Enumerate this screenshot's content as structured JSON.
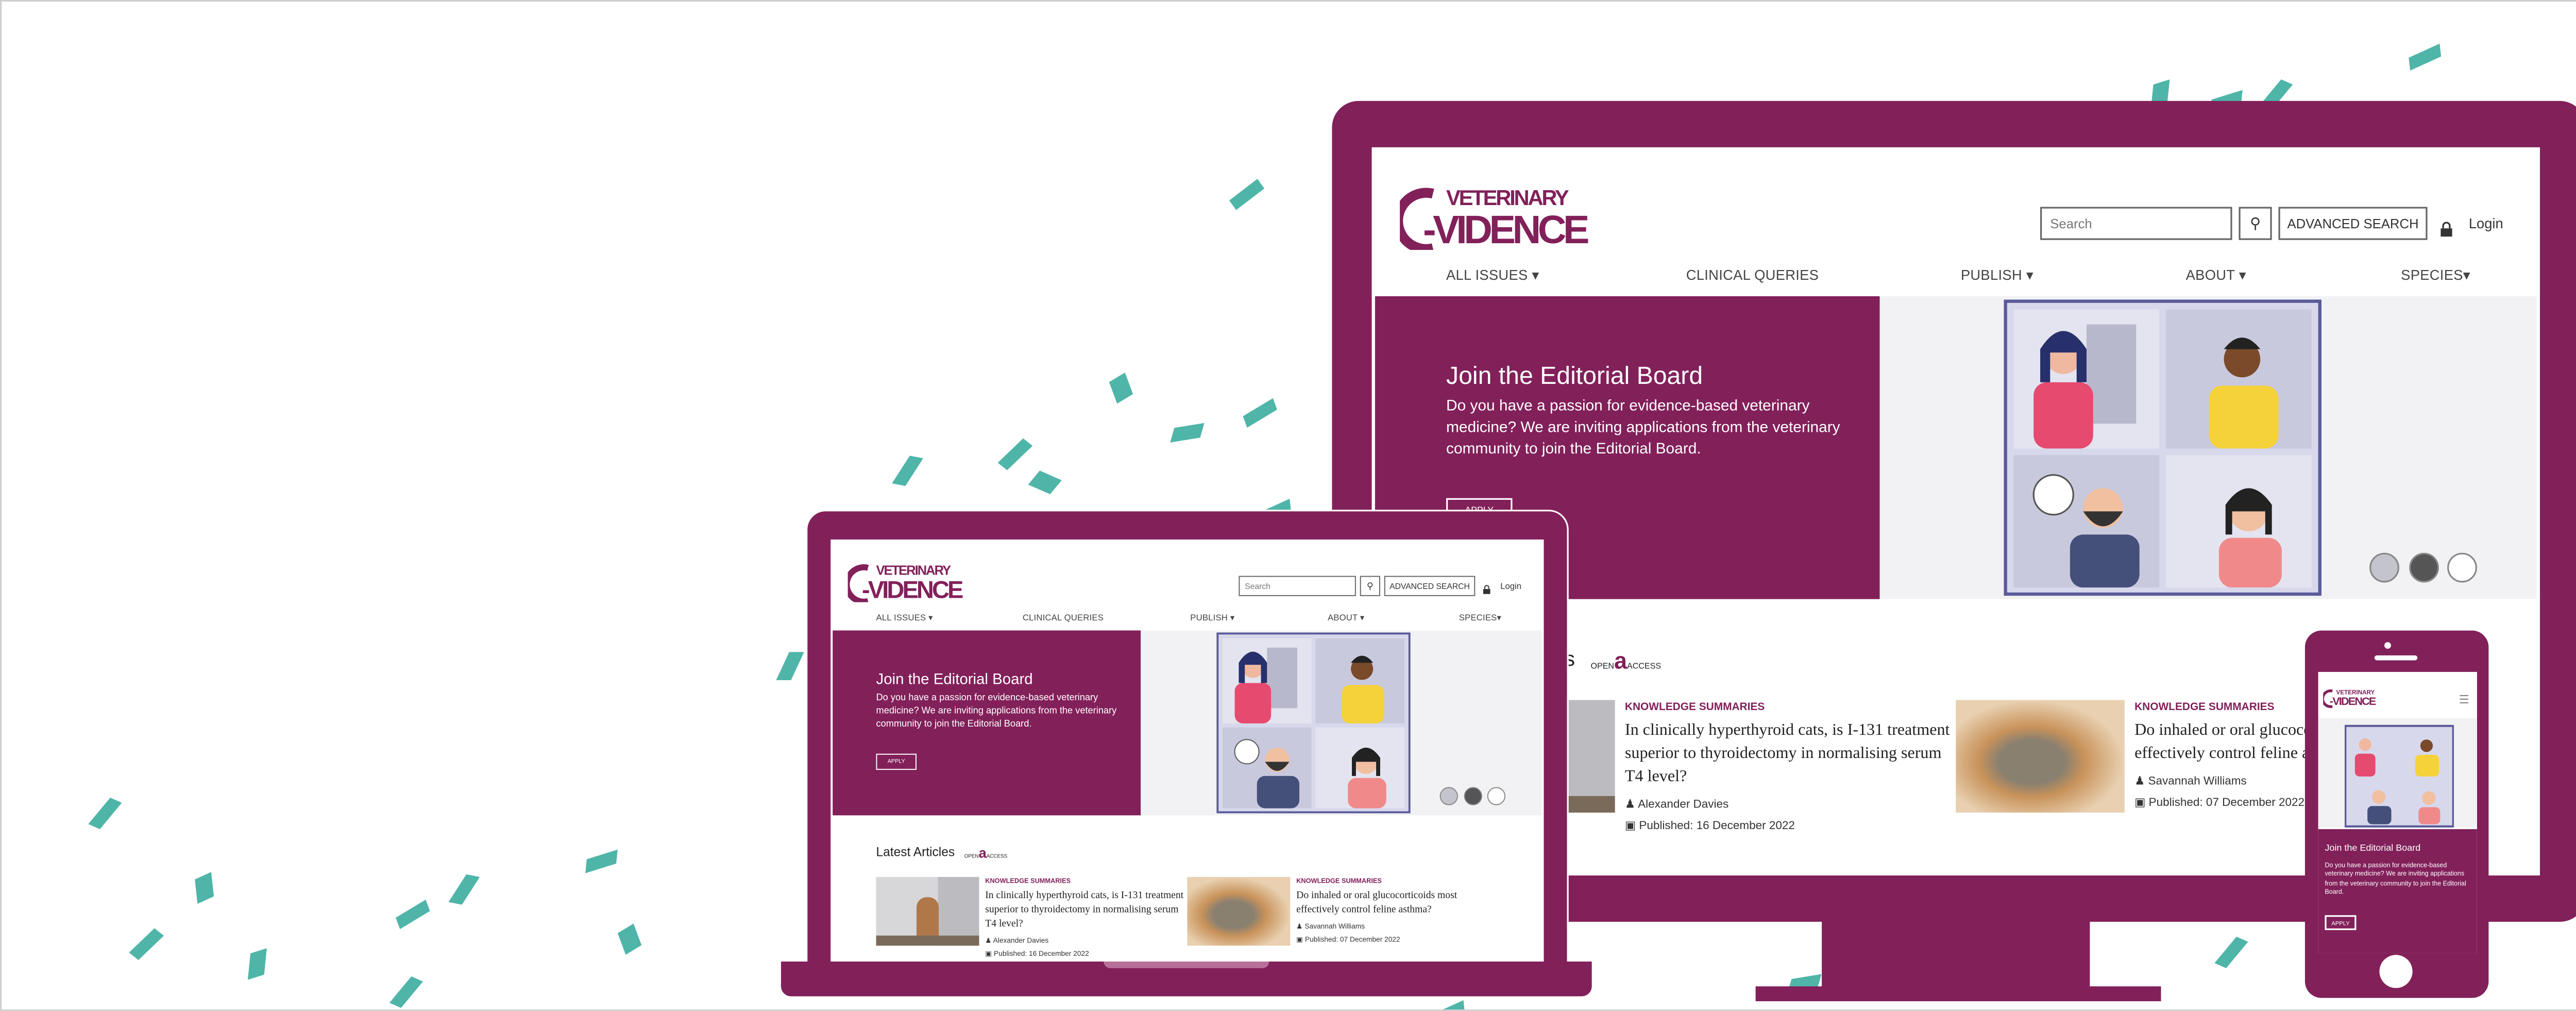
{
  "site": {
    "logo_text_top": "VETERINARY",
    "logo_text_bottom": "EVIDENCE",
    "search_placeholder": "Search",
    "advanced_search": "ADVANCED SEARCH",
    "login": "Login",
    "nav": [
      "ALL ISSUES ▾",
      "CLINICAL QUERIES",
      "PUBLISH ▾",
      "ABOUT ▾",
      "SPECIES▾"
    ],
    "hero": {
      "title": "Join the Editorial Board",
      "description": "Do you have a passion for evidence-based veterinary medicine? We are inviting applications from the veterinary community to join the Editorial Board.",
      "button": "APPLY"
    },
    "latest_title": "Latest Articles",
    "open_access": {
      "left": "OPEN",
      "right": "ACCESS"
    },
    "articles": [
      {
        "category": "KNOWLEDGE SUMMARIES",
        "title": "In clinically hyperthyroid cats, is I-131 treatment superior to thyroidectomy in normalising serum T4 level?",
        "author": "Alexander Davies",
        "published": "Published: 16 December 2022"
      },
      {
        "category": "KNOWLEDGE SUMMARIES",
        "title": "Do inhaled or oral glucocorticoids most effectively control feline asthma?",
        "author": "Savannah Williams",
        "published": "Published: 07 December 2022"
      }
    ]
  },
  "colors": {
    "brand": "#82205a",
    "confetti": "#4fb5a9",
    "hero_bg": "#f2f2f4"
  },
  "icons": [
    "search-icon",
    "lock-icon",
    "user-icon",
    "calendar-icon",
    "open-access-icon",
    "hamburger-icon"
  ]
}
